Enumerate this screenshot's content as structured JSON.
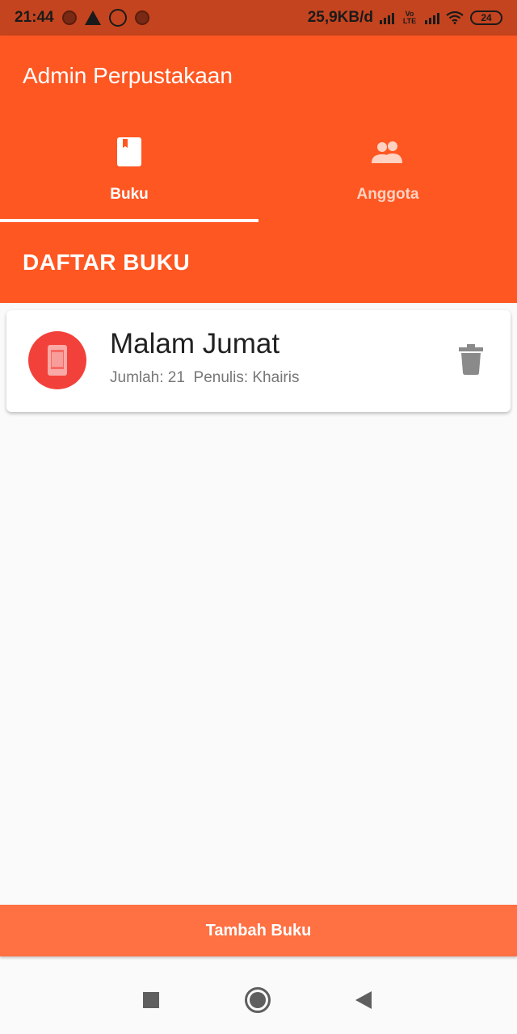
{
  "status_bar": {
    "time": "21:44",
    "network_speed": "25,9KB/d",
    "volte_label": "Vo LTE",
    "battery": "24"
  },
  "app_bar": {
    "title": "Admin Perpustakaan"
  },
  "tabs": [
    {
      "label": "Buku",
      "icon": "book-icon",
      "active": true
    },
    {
      "label": "Anggota",
      "icon": "people-icon",
      "active": false
    }
  ],
  "section": {
    "title": "DAFTAR BUKU"
  },
  "books": [
    {
      "title": "Malam Jumat",
      "jumlah_label": "Jumlah: 21",
      "penulis_label": "Penulis: Khairis"
    }
  ],
  "add_button": {
    "label": "Tambah Buku"
  },
  "colors": {
    "primary": "#ff5722",
    "status_bar": "#c4441f",
    "avatar": "#f2413a",
    "button": "#ff7043"
  }
}
